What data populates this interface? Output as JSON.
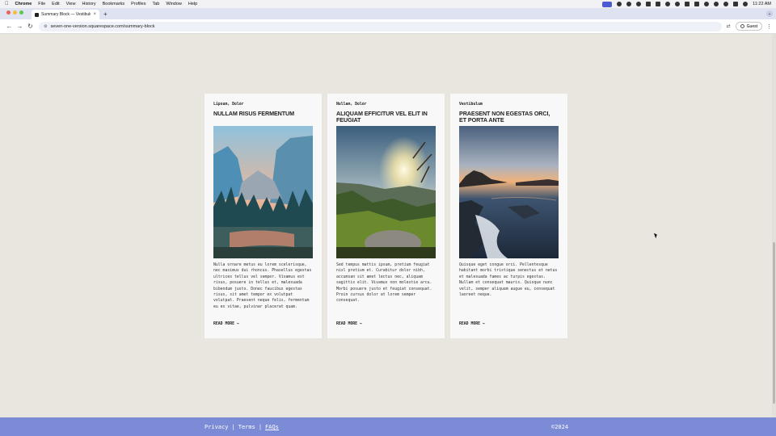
{
  "menubar": {
    "app": "Chrome",
    "items": [
      "File",
      "Edit",
      "View",
      "History",
      "Bookmarks",
      "Profiles",
      "Tab",
      "Window",
      "Help"
    ],
    "time": "11:22 AM"
  },
  "browser": {
    "tab_title": "Summary Block — Vestibulu...",
    "url": "seven-one-version.squarespace.com/summary-block",
    "guest_label": "Guest"
  },
  "cards": [
    {
      "category": "Lipsum, Dolor",
      "title": "NULLAM RISUS FERMENTUM",
      "excerpt": "Nulla ornare metus eu lorem scelerisque, nec maximus dui rhoncus. Phasellus egestas ultrices tellus vel semper. Vivamus est risus, posuere in tellus et, malesuada bibendum justo. Donec faucibus egestas risus, sit amet tempor ex volutpat volutpat. Praesent neque felis, fermentum eu ex vitae, pulvinar placerat quam.",
      "read_more": "READ MORE →",
      "image": "mountain-valley-river"
    },
    {
      "category": "Nullam, Dolor",
      "title": "ALIQUAM EFFICITUR VEL ELIT IN FEUGIAT",
      "excerpt": "Sed tempus mattis ipsum, pretium feugiat nisl pretium et. Curabitur dolor nibh, accumsan sit amet lectus nec, aliquam sagittis elit. Vivamus non molestie arcu. Morbi posuere justo et feugiat consequat. Proin cursus dolor at lorem semper consequat.",
      "read_more": "READ MORE →",
      "image": "sunset-hills"
    },
    {
      "category": "Vestibulum",
      "title": "PRAESENT NON EGESTAS ORCI, ET PORTA ANTE",
      "excerpt": "Quisque eget congue orci. Pellentesque habitant morbi tristique senectus et netus et malesuada fames ac turpis egestas. Nullam et consequat mauris. Quisque nunc velit, semper aliquam augue eu, consequat laoreet neque.",
      "read_more": "READ MORE →",
      "image": "rocky-coast-dusk"
    }
  ],
  "footer": {
    "privacy": "Privacy",
    "terms": "Terms",
    "faqs": "FAQs",
    "separator": "|",
    "copyright": "©2024"
  },
  "colors": {
    "page_bg": "#e9e6e0",
    "card_bg": "#f8f8f8",
    "footer_bg": "#7b8bd5"
  }
}
